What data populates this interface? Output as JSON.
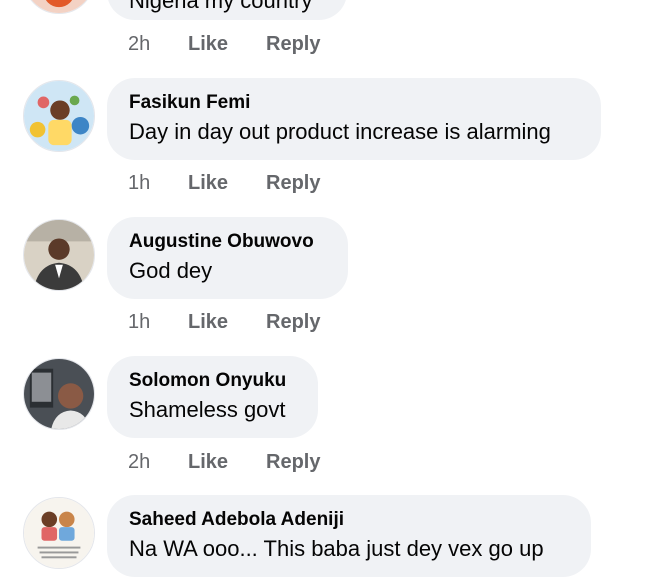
{
  "top_partial": {
    "text": "Nigeria my country",
    "meta": {
      "time": "2h",
      "like": "Like",
      "reply": "Reply"
    }
  },
  "comments": [
    {
      "name": "Fasikun Femi",
      "text": "Day in day out product increase is alarming",
      "meta": {
        "time": "1h",
        "like": "Like",
        "reply": "Reply"
      }
    },
    {
      "name": "Augustine Obuwovo",
      "text": "God dey",
      "meta": {
        "time": "1h",
        "like": "Like",
        "reply": "Reply"
      }
    },
    {
      "name": "Solomon Onyuku",
      "text": "Shameless govt",
      "meta": {
        "time": "2h",
        "like": "Like",
        "reply": "Reply"
      }
    },
    {
      "name": "Saheed Adebola Adeniji",
      "text": "Na WA ooo... This baba just dey vex go up"
    }
  ],
  "colors": {
    "bubble": "#f0f2f5",
    "meta": "#65676b",
    "text": "#050505"
  }
}
